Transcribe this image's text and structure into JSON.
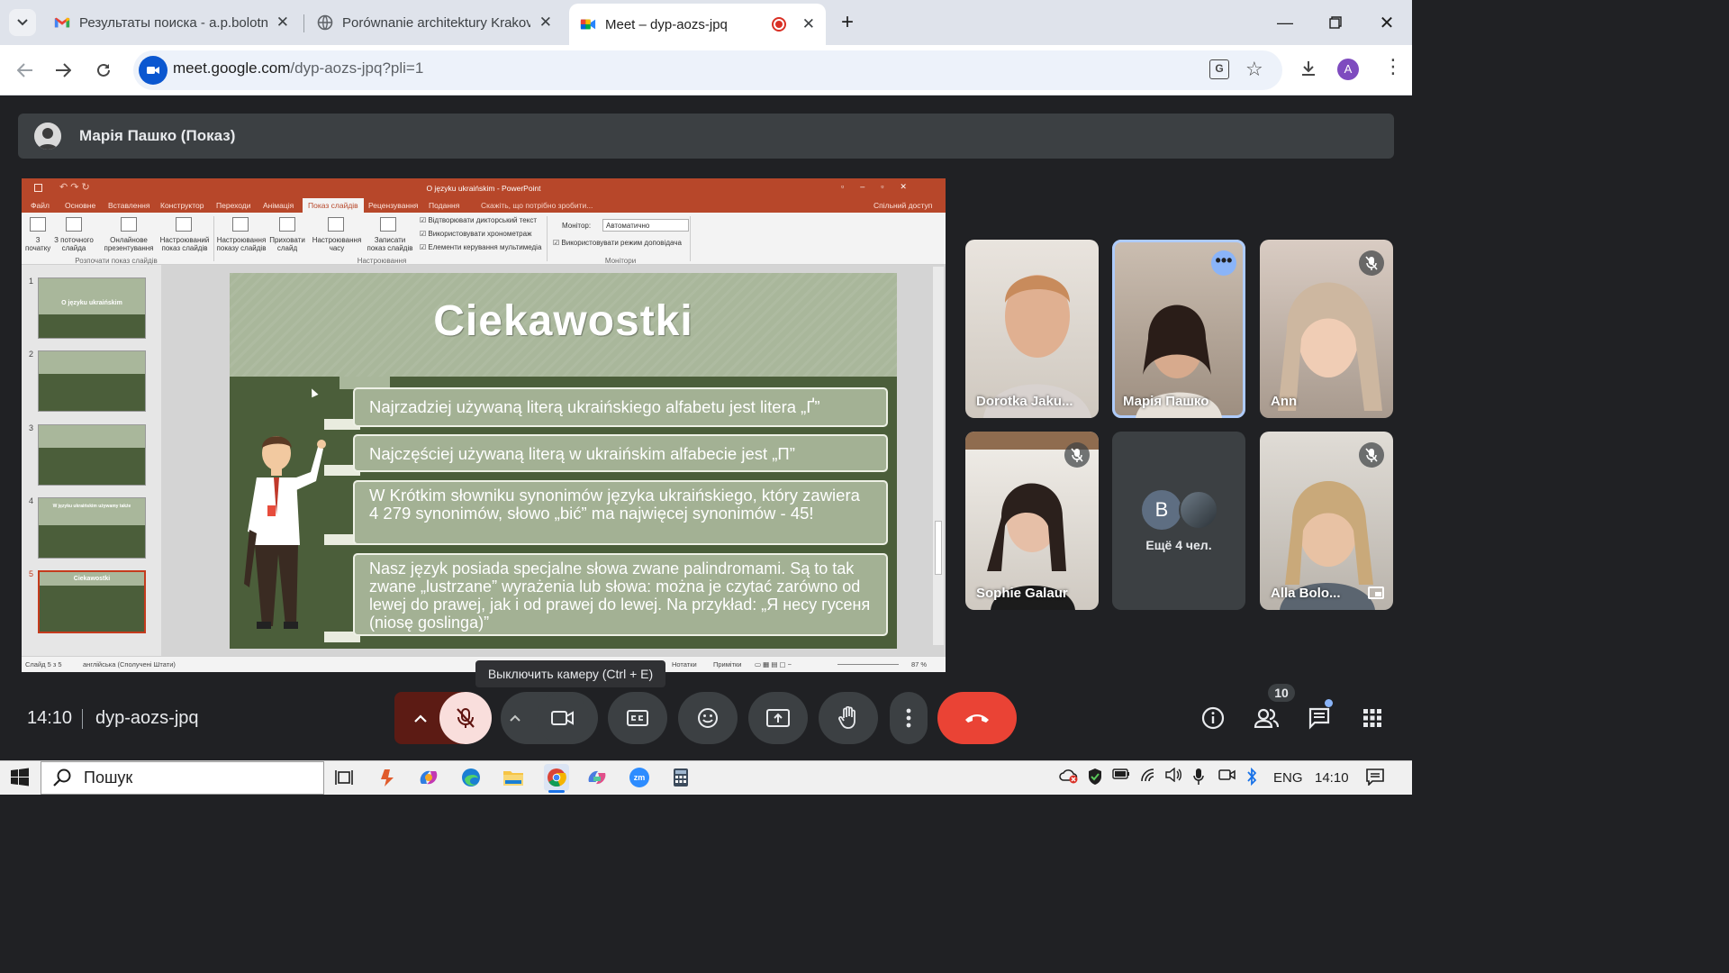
{
  "browser": {
    "tabs": [
      {
        "title": "Результаты поиска - a.p.bolotn",
        "icon": "gmail-icon"
      },
      {
        "title": "Porównanie architektury Krakov",
        "icon": "globe-icon"
      },
      {
        "title": "Meet – dyp-aozs-jpq",
        "icon": "meet-icon"
      }
    ],
    "url_main": "meet.google.com",
    "url_path": "/dyp-aozs-jpq?pli=1",
    "profile_initial": "A"
  },
  "meet": {
    "presenter_label": "Марія Пашко (Показ)",
    "tooltip": "Выключить камеру (Ctrl + E)",
    "clock": "14:10",
    "meeting_code": "dyp-aozs-jpq",
    "participants_badge": "10",
    "more_participants": "Ещё 4 чел.",
    "more_initial": "B",
    "tiles": [
      {
        "name": "Dorotka Jaku...",
        "muted": false
      },
      {
        "name": "Марія Пашко",
        "muted": false
      },
      {
        "name": "Ann",
        "muted": true
      },
      {
        "name": "Sophie Galaur",
        "muted": true
      },
      {
        "name": "Alla Bolo...",
        "muted": true
      }
    ]
  },
  "ppt": {
    "window_title": "O języku ukraińskim - PowerPoint",
    "tabs": [
      "Файл",
      "Основне",
      "Вставлення",
      "Конструктор",
      "Переходи",
      "Анімація",
      "Показ слайдів",
      "Рецензування",
      "Подання"
    ],
    "tell_me": "Скажіть, що потрібно зробити...",
    "share": "Спільний доступ",
    "ribbon": {
      "btn1": "З початку",
      "btn2": "З поточного слайда",
      "btn3": "Онлайнове презентування",
      "btn4": "Настроюваний показ слайдів",
      "group1": "Розпочати показ слайдів",
      "btn5": "Настроювання показу слайдів",
      "btn6": "Приховати слайд",
      "btn7": "Настроювання часу",
      "btn8": "Записати показ слайдів",
      "chk1": "Відтворювати дикторський текст",
      "chk2": "Використовувати хронометраж",
      "chk3": "Елементи керування мультимедіа",
      "group2": "Настроювання",
      "monitor_label": "Монітор:",
      "monitor_value": "Автоматично",
      "chk4": "Використовувати режим доповідача",
      "group3": "Монітори"
    },
    "thumbs": [
      {
        "num": "1",
        "title": "O języku ukraińskim"
      },
      {
        "num": "2",
        "title": ""
      },
      {
        "num": "3",
        "title": ""
      },
      {
        "num": "4",
        "title": "W języku ukraińskim używamy także"
      },
      {
        "num": "5",
        "title": "Ciekawostki"
      }
    ],
    "status_slide": "Слайд 5 з 5",
    "status_lang": "англійська (Сполучені Штати)",
    "status_notes": "Нотатки",
    "status_comments": "Примітки",
    "zoom": "87 %"
  },
  "slide": {
    "title": "Ciekawostki",
    "facts": [
      "Najrzadziej używaną literą ukraińskiego alfabetu jest litera „Ґ”",
      "Najczęściej używaną literą w ukraińskim alfabecie jest „П”",
      "W Krótkim słowniku synonimów języka ukraińskiego, który zawiera 4 279 synonimów, słowo „bić” ma najwięcej synonimów - 45!",
      "Nasz język posiada specjalne słowa zwane palindromami. Są to tak zwane „lustrzane” wyrażenia lub słowa: można je czytać zarówno od lewej do prawej, jak i od prawej do lewej. Na przykład: „Я несу гусеня (niosę goslinga)”"
    ]
  },
  "taskbar": {
    "search_placeholder": "Пошук",
    "lang": "ENG",
    "time": "14:10"
  },
  "colors": {
    "meet_bg": "#202124",
    "ppt_accent": "#b7472a",
    "slide_light": "#a9b79b",
    "slide_dark": "#4b5e3a",
    "hangup_red": "#ea4335",
    "active_blue": "#aecbfa"
  }
}
